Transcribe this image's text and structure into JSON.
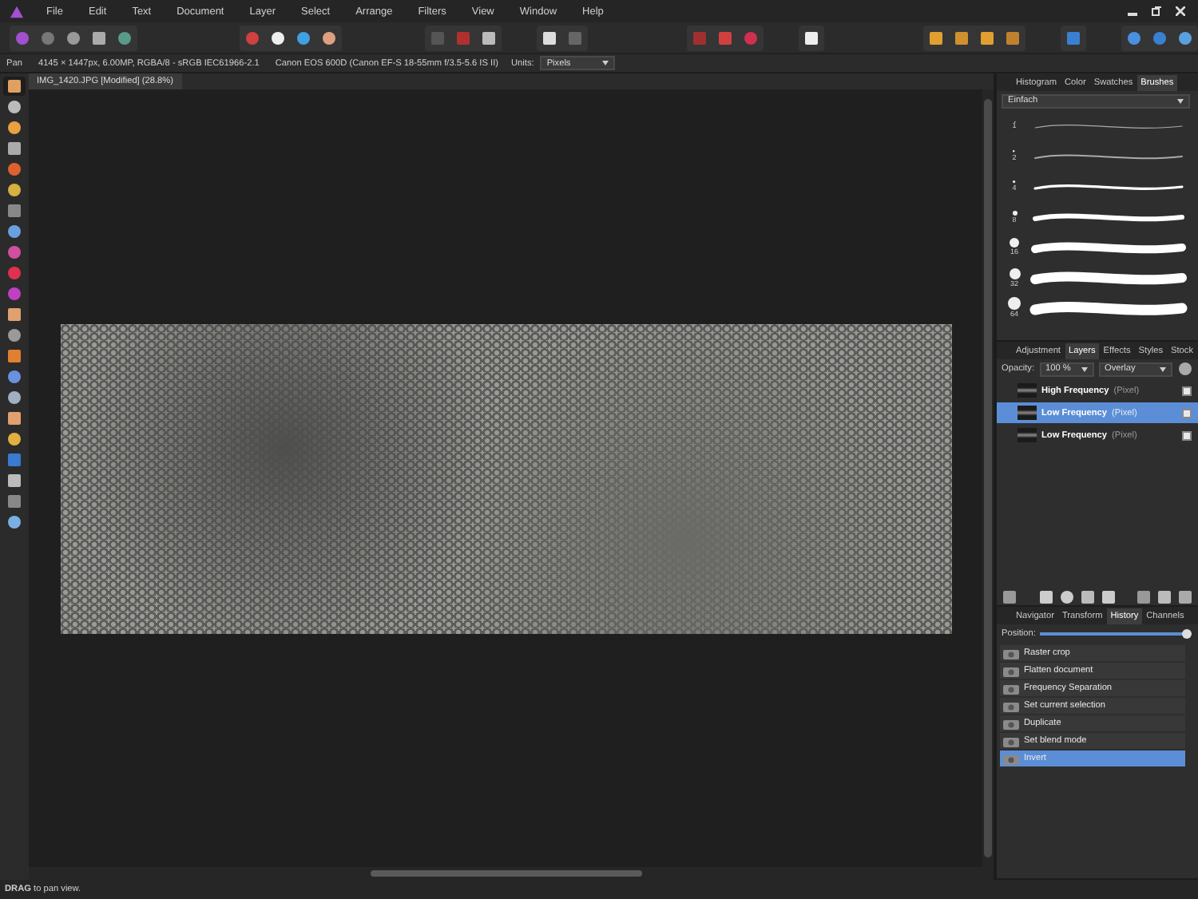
{
  "menu": [
    "File",
    "Edit",
    "Text",
    "Document",
    "Layer",
    "Select",
    "Arrange",
    "Filters",
    "View",
    "Window",
    "Help"
  ],
  "context_bar": {
    "tool": "Pan",
    "image_info": "4145 × 1447px, 6.00MP, RGBA/8 - sRGB IEC61966-2.1",
    "camera": "Canon EOS 600D (Canon EF-S 18-55mm f/3.5-5.6 IS II)",
    "units_label": "Units:",
    "units_value": "Pixels"
  },
  "document_tab": {
    "title": "IMG_1420.JPG [Modified] (28.8%)"
  },
  "brushes_panel": {
    "tabs": [
      {
        "label": "Histogram",
        "selected": false
      },
      {
        "label": "Color",
        "selected": false
      },
      {
        "label": "Swatches",
        "selected": false
      },
      {
        "label": "Brushes",
        "selected": true
      }
    ],
    "category": "Einfach",
    "brushes": [
      {
        "size": "1"
      },
      {
        "size": "2"
      },
      {
        "size": "4"
      },
      {
        "size": "8"
      },
      {
        "size": "16"
      },
      {
        "size": "32"
      },
      {
        "size": "64"
      }
    ]
  },
  "layers_panel": {
    "tabs": [
      {
        "label": "Adjustment",
        "selected": false
      },
      {
        "label": "Layers",
        "selected": true
      },
      {
        "label": "Effects",
        "selected": false
      },
      {
        "label": "Styles",
        "selected": false
      },
      {
        "label": "Stock",
        "selected": false
      }
    ],
    "opacity_label": "Opacity:",
    "opacity_value": "100 %",
    "blend_mode": "Overlay",
    "layers": [
      {
        "name": "High Frequency",
        "type": "(Pixel)",
        "selected": false,
        "visible": true
      },
      {
        "name": "Low Frequency",
        "type": "(Pixel)",
        "selected": true,
        "visible": true
      },
      {
        "name": "Low Frequency",
        "type": "(Pixel)",
        "selected": false,
        "visible": true
      }
    ]
  },
  "history_panel": {
    "tabs": [
      {
        "label": "Navigator",
        "selected": false
      },
      {
        "label": "Transform",
        "selected": false
      },
      {
        "label": "History",
        "selected": true
      },
      {
        "label": "Channels",
        "selected": false
      }
    ],
    "position_label": "Position:",
    "position": {
      "level": 1
    },
    "items": [
      {
        "label": "Raster crop",
        "selected": false
      },
      {
        "label": "Flatten document",
        "selected": false
      },
      {
        "label": "Frequency Separation",
        "selected": false
      },
      {
        "label": "Set current selection",
        "selected": false
      },
      {
        "label": "Duplicate",
        "selected": false
      },
      {
        "label": "Set blend mode",
        "selected": false
      },
      {
        "label": "Invert",
        "selected": true
      }
    ]
  },
  "status_bar": {
    "hint": "**DRAG** to pan view."
  }
}
